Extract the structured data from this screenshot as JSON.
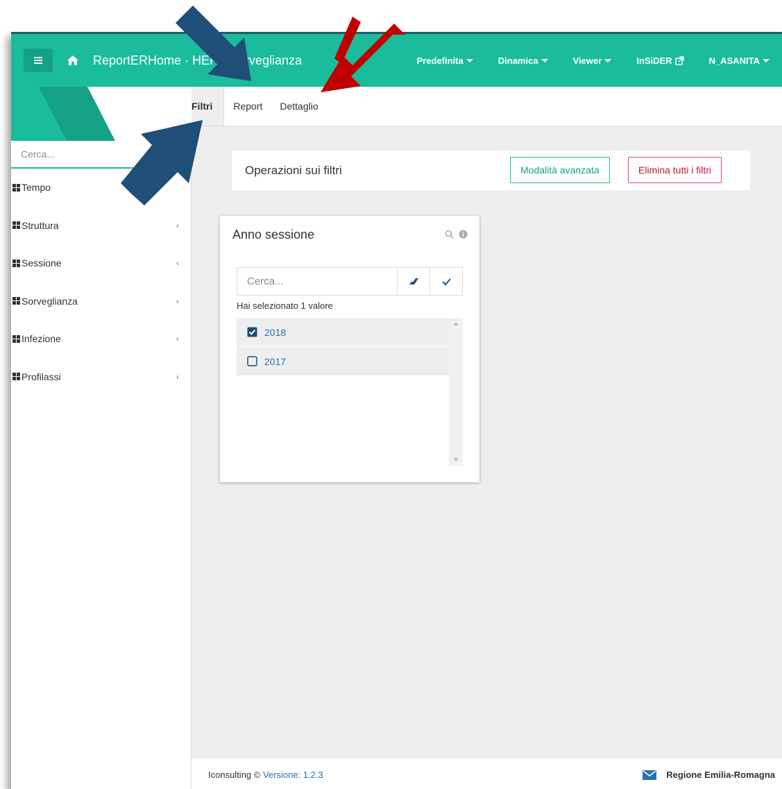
{
  "navbar": {
    "brand": "ReportERHome · HER - Sorveglianza",
    "items": [
      {
        "label": "Predefinita",
        "has_caret": true
      },
      {
        "label": "Dinamica",
        "has_caret": true
      },
      {
        "label": "Viewer",
        "has_caret": true
      },
      {
        "label": "InSiDER",
        "external_link": true
      },
      {
        "label": "N_ASANITA",
        "has_caret": true
      }
    ],
    "icons": [
      "hamburger-icon",
      "home-icon",
      "external-link-icon",
      "caret-down-icon"
    ]
  },
  "sidebar": {
    "search_placeholder": "Cerca...",
    "items": [
      {
        "label": "Tempo",
        "icon": "grid-icon",
        "has_chevron": false
      },
      {
        "label": "Struttura",
        "icon": "grid-icon",
        "has_chevron": true
      },
      {
        "label": "Sessione",
        "icon": "grid-icon",
        "has_chevron": true
      },
      {
        "label": "Sorveglianza",
        "icon": "grid-icon",
        "has_chevron": true
      },
      {
        "label": "Infezione",
        "icon": "grid-icon",
        "has_chevron": true
      },
      {
        "label": "Profilassi",
        "icon": "grid-icon",
        "has_chevron": true
      }
    ],
    "chevron_glyph": "‹"
  },
  "tabs": [
    {
      "label": "Filtri",
      "active": true
    },
    {
      "label": "Report",
      "active": false
    },
    {
      "label": "Dettaglio",
      "active": false
    }
  ],
  "operations": {
    "title": "Operazioni sui filtri",
    "advanced_button": "Modalità avanzata",
    "delete_all_button": "Elimina tutti i filtri"
  },
  "filter_card": {
    "title": "Anno sessione",
    "search_placeholder": "Cerca...",
    "selected_count_text": "Hai selezionato 1 valore",
    "values": [
      {
        "label": "2018",
        "checked": true
      },
      {
        "label": "2017",
        "checked": false
      }
    ]
  },
  "footer": {
    "company": "Iconsulting ©",
    "version": "Versione: 1.2.3",
    "region": "Regione Emilia-Romagna"
  },
  "colors": {
    "accent": "#1abc9c",
    "accent_dark": "#16a085",
    "danger": "#e24b5c",
    "link": "#2a6fb0",
    "arrow_blue": "#1f4e79",
    "arrow_red": "#c00000"
  }
}
